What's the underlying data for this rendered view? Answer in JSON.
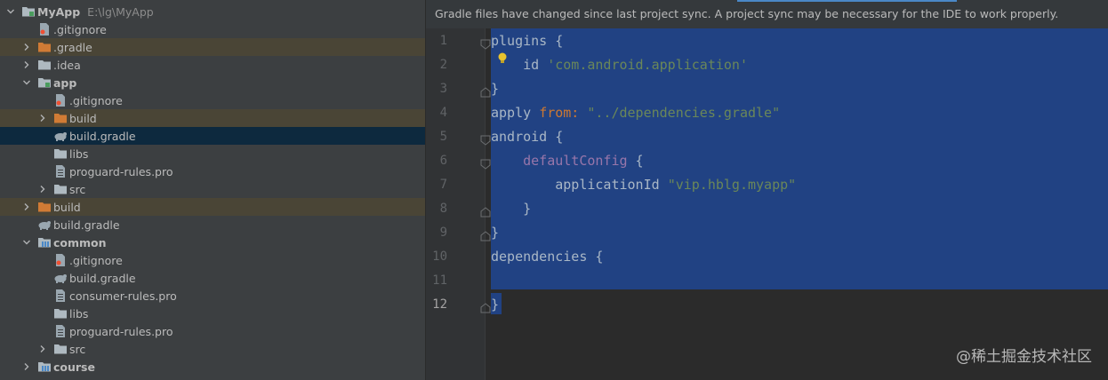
{
  "tree": {
    "items": [
      {
        "label": "MyApp",
        "path": "E:\\lg\\MyApp",
        "icon": "module-folder-icon",
        "chev": "expanded",
        "depth": 0,
        "bold": true
      },
      {
        "label": ".gitignore",
        "icon": "gitignore-file-icon",
        "chev": "none",
        "depth": 1
      },
      {
        "label": ".gradle",
        "icon": "excluded-folder-icon",
        "chev": "collapsed",
        "depth": 1,
        "state": "excluded"
      },
      {
        "label": ".idea",
        "icon": "folder-icon",
        "chev": "collapsed",
        "depth": 1
      },
      {
        "label": "app",
        "icon": "module-folder-icon",
        "chev": "expanded",
        "depth": 1,
        "bold": true
      },
      {
        "label": ".gitignore",
        "icon": "gitignore-file-icon",
        "chev": "none",
        "depth": 2
      },
      {
        "label": "build",
        "icon": "excluded-folder-icon",
        "chev": "collapsed",
        "depth": 2,
        "state": "excluded"
      },
      {
        "label": "build.gradle",
        "icon": "gradle-file-icon",
        "chev": "none",
        "depth": 2,
        "state": "selected"
      },
      {
        "label": "libs",
        "icon": "folder-icon",
        "chev": "none",
        "depth": 2
      },
      {
        "label": "proguard-rules.pro",
        "icon": "text-file-icon",
        "chev": "none",
        "depth": 2
      },
      {
        "label": "src",
        "icon": "folder-icon",
        "chev": "collapsed",
        "depth": 2
      },
      {
        "label": "build",
        "icon": "excluded-folder-icon",
        "chev": "collapsed",
        "depth": 1,
        "state": "excluded"
      },
      {
        "label": "build.gradle",
        "icon": "gradle-file-icon",
        "chev": "none",
        "depth": 1
      },
      {
        "label": "common",
        "icon": "library-module-icon",
        "chev": "expanded",
        "depth": 1,
        "bold": true
      },
      {
        "label": ".gitignore",
        "icon": "gitignore-file-icon",
        "chev": "none",
        "depth": 2
      },
      {
        "label": "build.gradle",
        "icon": "gradle-file-icon",
        "chev": "none",
        "depth": 2
      },
      {
        "label": "consumer-rules.pro",
        "icon": "text-file-icon",
        "chev": "none",
        "depth": 2
      },
      {
        "label": "libs",
        "icon": "folder-icon",
        "chev": "none",
        "depth": 2
      },
      {
        "label": "proguard-rules.pro",
        "icon": "text-file-icon",
        "chev": "none",
        "depth": 2
      },
      {
        "label": "src",
        "icon": "folder-icon",
        "chev": "collapsed",
        "depth": 2
      },
      {
        "label": "course",
        "icon": "library-module-icon",
        "chev": "collapsed",
        "depth": 1,
        "bold": true
      }
    ]
  },
  "editor": {
    "banner": "Gradle files have changed since last project sync. A project sync may be necessary for the IDE to work properly.",
    "line_numbers": [
      "1",
      "2",
      "3",
      "4",
      "5",
      "6",
      "7",
      "8",
      "9",
      "10",
      "11",
      "12"
    ],
    "lines": [
      [
        {
          "t": "plugins {",
          "c": ""
        }
      ],
      [
        {
          "t": "    id ",
          "c": ""
        },
        {
          "t": "'com.android.application'",
          "c": "s"
        }
      ],
      [
        {
          "t": "}",
          "c": ""
        }
      ],
      [
        {
          "t": "apply ",
          "c": ""
        },
        {
          "t": "from:",
          "c": "k"
        },
        {
          "t": " ",
          "c": ""
        },
        {
          "t": "\"../dependencies.gradle\"",
          "c": "s"
        }
      ],
      [
        {
          "t": "android {",
          "c": ""
        }
      ],
      [
        {
          "t": "    ",
          "c": ""
        },
        {
          "t": "defaultConfig",
          "c": "m"
        },
        {
          "t": " {",
          "c": ""
        }
      ],
      [
        {
          "t": "        applicationId ",
          "c": ""
        },
        {
          "t": "\"vip.hblg.myapp\"",
          "c": "s"
        }
      ],
      [
        {
          "t": "    }",
          "c": ""
        }
      ],
      [
        {
          "t": "}",
          "c": ""
        }
      ],
      [
        {
          "t": "dependencies {",
          "c": ""
        }
      ],
      [
        {
          "t": "",
          "c": ""
        }
      ],
      [
        {
          "t": "}",
          "c": ""
        }
      ]
    ],
    "fold_markers": [
      "open",
      "none",
      "close",
      "none",
      "open",
      "open",
      "none",
      "close",
      "close",
      "none",
      "none",
      "close"
    ]
  },
  "watermark": "@稀土掘金技术社区",
  "colors": {
    "accent": "#4a88c7",
    "selection": "#214283",
    "excluded_folder": "#d07b35"
  }
}
